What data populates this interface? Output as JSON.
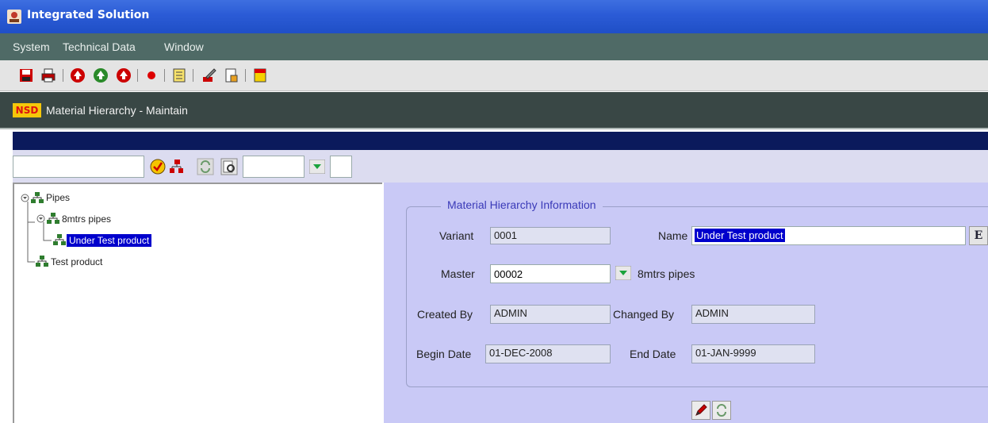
{
  "window": {
    "title": "Integrated Solution",
    "app_icon": "app-icon"
  },
  "menu": [
    {
      "label": "System"
    },
    {
      "label": "Technical Data"
    },
    {
      "label": "Window"
    }
  ],
  "toolbar": {
    "buttons": [
      "save-icon",
      "print-icon",
      "record-up-icon",
      "record-insert-icon",
      "record-next-icon",
      "record-dot-icon",
      "list-icon",
      "edit-pencil-icon",
      "query-icon",
      "exit-icon"
    ]
  },
  "form": {
    "logo": "NSD",
    "title": "Material  Hierarchy - Maintain"
  },
  "subtoolbar": {
    "search_value": "",
    "combo_value": "",
    "extra_value": ""
  },
  "tree": {
    "nodes": [
      {
        "label": "Pipes",
        "level": 0,
        "expanded": true
      },
      {
        "label": "8mtrs pipes",
        "level": 1,
        "expanded": true
      },
      {
        "label": "Under Test product",
        "level": 2,
        "selected": true
      },
      {
        "label": "Test product",
        "level": 1
      }
    ]
  },
  "details": {
    "group_title": "Material Hierarchy Information",
    "variant_label": "Variant",
    "variant_value": "0001",
    "name_label": "Name",
    "name_value": "Under Test product",
    "name_button": "E",
    "master_label": "Master",
    "master_value": "00002",
    "master_desc": "8mtrs pipes",
    "created_by_label": "Created By",
    "created_by_value": "ADMIN",
    "changed_by_label": "Changed By",
    "changed_by_value": "ADMIN",
    "begin_date_label": "Begin Date",
    "begin_date_value": "01-DEC-2008",
    "end_date_label": "End Date",
    "end_date_value": "01-JAN-9999"
  },
  "colors": {
    "title_bar": "#2b5bd6",
    "menu_bar": "#4f6a66",
    "header_bar": "#394745",
    "dark_strip": "#0b1a5c",
    "form_bg": "#c9c9f6",
    "selection": "#0000cc"
  }
}
